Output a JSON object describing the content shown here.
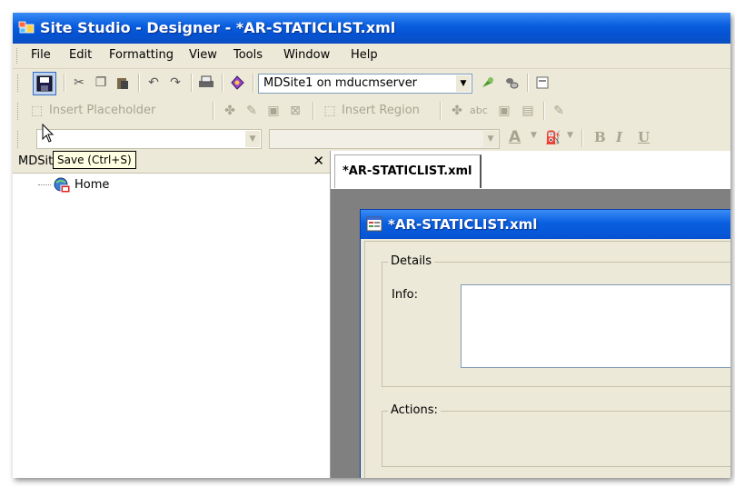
{
  "window": {
    "title": "Site Studio - Designer - *AR-STATICLIST.xml"
  },
  "menubar": {
    "items": [
      "File",
      "Edit",
      "Formatting",
      "View",
      "Tools",
      "Window",
      "Help"
    ]
  },
  "toolbar": {
    "site_combo_value": "MDSite1 on mducmserver",
    "insert_placeholder_label": "Insert Placeholder",
    "insert_region_label": "Insert Region",
    "abc_label": "abc",
    "bold_label": "B",
    "italic_label": "I",
    "underline_label": "U",
    "font_color_letter": "A"
  },
  "tooltip": {
    "text": "Save (Ctrl+S)"
  },
  "site_pane": {
    "header": "MDSite1 (MDSite1)",
    "close_glyph": "✕",
    "tree": [
      {
        "label": "Home"
      }
    ]
  },
  "editor": {
    "tab_label": "*AR-STATICLIST.xml",
    "doc_title": "*AR-STATICLIST.xml",
    "details_group": "Details",
    "info_label": "Info:",
    "info_value": "",
    "actions_group": "Actions:"
  },
  "colors": {
    "title_bar": "#0553d2",
    "face": "#ece9d8",
    "tooltip_bg": "#ffffe1"
  }
}
